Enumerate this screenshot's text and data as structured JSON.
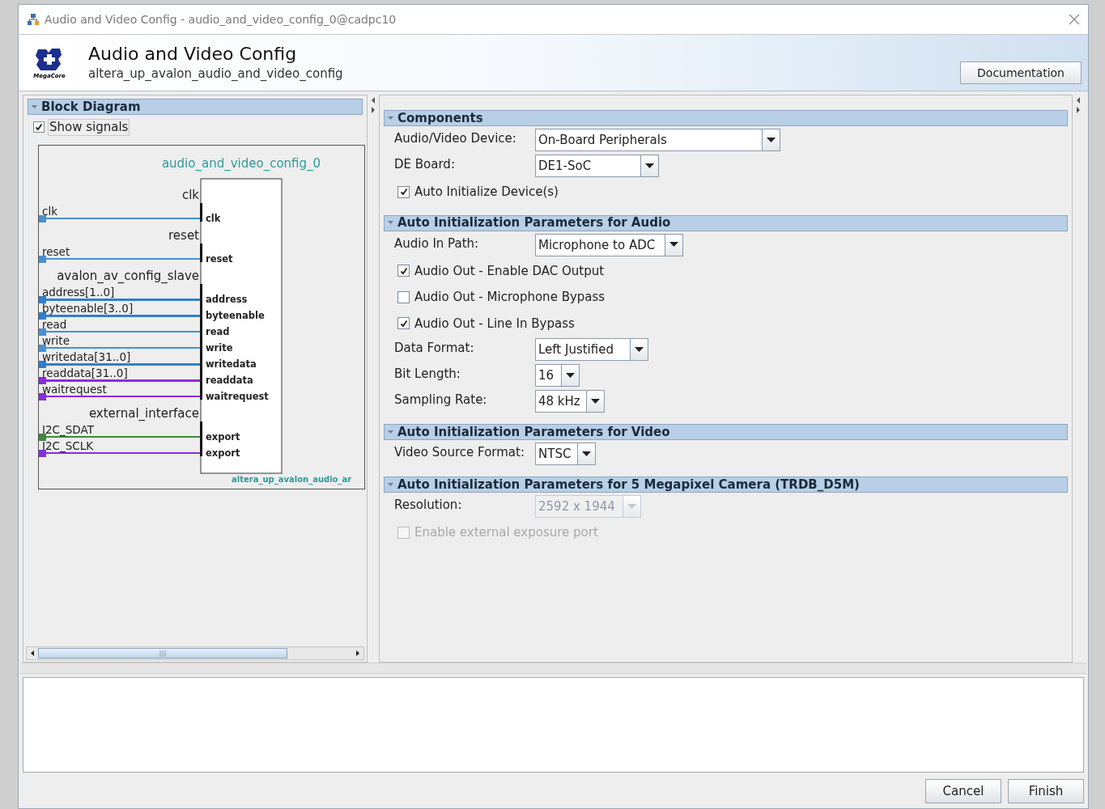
{
  "window": {
    "title": "Audio and Video Config - audio_and_video_config_0@cadpc10"
  },
  "header": {
    "logo_text": "MegaCore",
    "title": "Audio and Video Config",
    "subtitle": "altera_up_avalon_audio_and_video_config",
    "documentation_button": "Documentation"
  },
  "block_diagram": {
    "title": "Block Diagram",
    "expanded": true,
    "show_signals": {
      "label": "Show signals",
      "checked": true
    },
    "component_name": "audio_and_video_config_0",
    "module_label": "altera_up_avalon_audio_ar",
    "interfaces": [
      {
        "name": "clk",
        "signals": [
          {
            "name": "clk",
            "port": "clk",
            "color": "#4a8fd4"
          }
        ]
      },
      {
        "name": "reset",
        "signals": [
          {
            "name": "reset",
            "port": "reset",
            "color": "#4a8fd4"
          }
        ]
      },
      {
        "name": "avalon_av_config_slave",
        "signals": [
          {
            "name": "address[1..0]",
            "port": "address",
            "color": "#2f7fd0"
          },
          {
            "name": "byteenable[3..0]",
            "port": "byteenable",
            "color": "#2f7fd0"
          },
          {
            "name": "read",
            "port": "read",
            "color": "#4a8fd4"
          },
          {
            "name": "write",
            "port": "write",
            "color": "#4a8fd4"
          },
          {
            "name": "writedata[31..0]",
            "port": "writedata",
            "color": "#2f7fd0"
          },
          {
            "name": "readdata[31..0]",
            "port": "readdata",
            "color": "#8a2be2"
          },
          {
            "name": "waitrequest",
            "port": "waitrequest",
            "color": "#8a2be2"
          }
        ]
      },
      {
        "name": "external_interface",
        "signals": [
          {
            "name": "I2C_SDAT",
            "port": "export",
            "color": "#3a8a3a"
          },
          {
            "name": "I2C_SCLK",
            "port": "export",
            "color": "#8a2be2"
          }
        ]
      }
    ]
  },
  "sections": [
    {
      "title": "Components",
      "expanded": true,
      "items": [
        {
          "kind": "dropdown",
          "label": "Audio/Video Device:",
          "value": "On-Board Peripherals",
          "disabled": false
        },
        {
          "kind": "dropdown",
          "label": "DE Board:",
          "value": "DE1-SoC",
          "disabled": false
        },
        {
          "kind": "checkbox",
          "label": "Auto Initialize Device(s)",
          "checked": true,
          "disabled": false
        }
      ]
    },
    {
      "title": "Auto Initialization Parameters for Audio",
      "expanded": true,
      "items": [
        {
          "kind": "dropdown",
          "label": "Audio In Path:",
          "value": "Microphone to ADC",
          "disabled": false
        },
        {
          "kind": "checkbox",
          "label": "Audio Out - Enable DAC Output",
          "checked": true,
          "disabled": false
        },
        {
          "kind": "checkbox",
          "label": "Audio Out - Microphone Bypass",
          "checked": false,
          "disabled": false
        },
        {
          "kind": "checkbox",
          "label": "Audio Out - Line In Bypass",
          "checked": true,
          "disabled": false
        },
        {
          "kind": "dropdown",
          "label": "Data Format:",
          "value": "Left Justified",
          "disabled": false
        },
        {
          "kind": "dropdown",
          "label": "Bit Length:",
          "value": "16",
          "disabled": false
        },
        {
          "kind": "dropdown",
          "label": "Sampling Rate:",
          "value": "48 kHz",
          "disabled": false
        }
      ]
    },
    {
      "title": "Auto Initialization Parameters for Video",
      "expanded": true,
      "items": [
        {
          "kind": "dropdown",
          "label": "Video Source Format:",
          "value": "NTSC",
          "disabled": false
        }
      ]
    },
    {
      "title": "Auto Initialization Parameters for 5 Megapixel Camera (TRDB_D5M)",
      "expanded": true,
      "items": [
        {
          "kind": "dropdown",
          "label": "Resolution:",
          "value": "2592 x 1944",
          "disabled": true
        },
        {
          "kind": "checkbox",
          "label": "Enable external exposure port",
          "checked": false,
          "disabled": true
        }
      ]
    }
  ],
  "buttons": [
    {
      "label": "Cancel"
    },
    {
      "label": "Finish"
    }
  ]
}
